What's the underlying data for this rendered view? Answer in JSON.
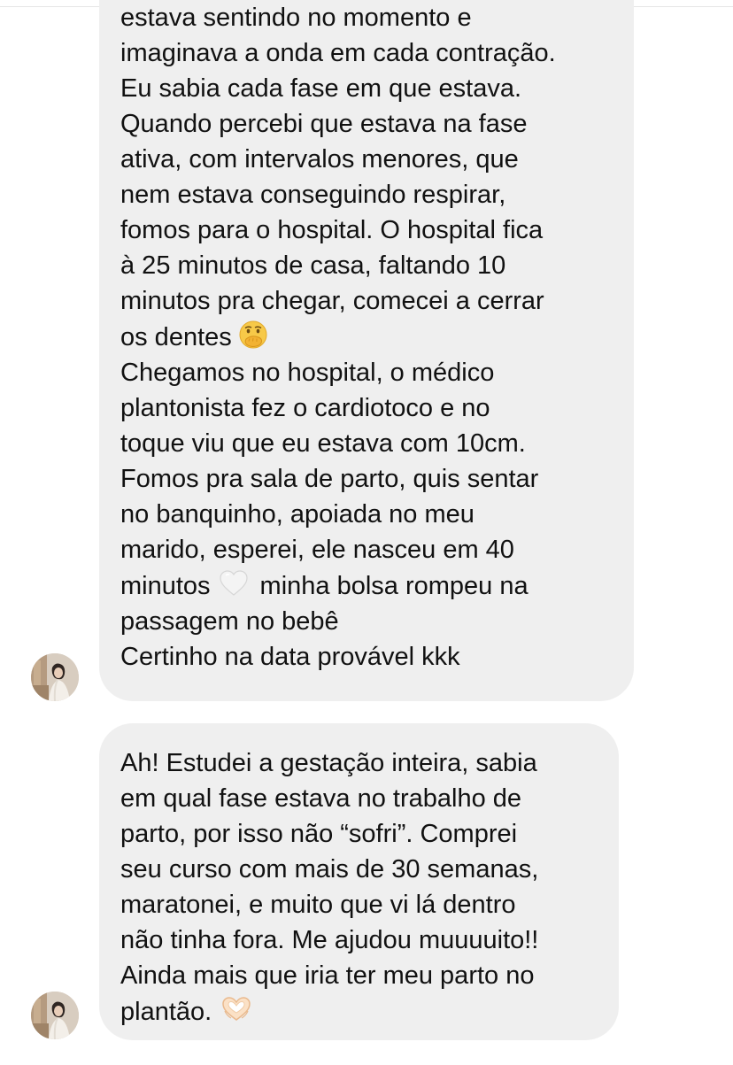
{
  "thread": {
    "messages": [
      {
        "lines": [
          "estava sentindo no momento e",
          "imaginava a onda em cada contração.",
          "Eu sabia cada fase em que estava.",
          "Quando percebi que estava na fase",
          "ativa, com intervalos menores, que",
          "nem estava conseguindo respirar,",
          "fomos para o hospital. O hospital fica",
          "à 25 minutos de casa, faltando 10",
          "minutos pra chegar, comecei a cerrar",
          "os dentes",
          "Chegamos no hospital, o médico",
          "plantonista fez o cardiotoco e no",
          "toque viu que eu estava com 10cm.",
          "Fomos pra sala de parto, quis sentar",
          "no banquinho, apoiada no meu",
          "marido, esperei, ele nasceu em 40",
          "minutos",
          "minha bolsa rompeu na",
          "passagem no bebê",
          "Certinho na data provável kkk"
        ],
        "emojis": [
          "face-with-hand-over-mouth-emoji",
          "white-heart-emoji"
        ]
      },
      {
        "lines": [
          "Ah! Estudei a gestação inteira, sabia",
          "em qual fase estava no trabalho de",
          "parto, por isso não “sofri”. Comprei",
          "seu curso com mais de 30 semanas,",
          "maratonei, e muito que vi lá dentro",
          "não tinha fora. Me ajudou muuuuito!!",
          "Ainda mais que iria ter meu parto no",
          "plantão."
        ],
        "emojis": [
          "heart-hands-emoji"
        ]
      }
    ]
  },
  "colors": {
    "bubble_background": "#efefef",
    "text": "#111111",
    "background": "#ffffff"
  }
}
